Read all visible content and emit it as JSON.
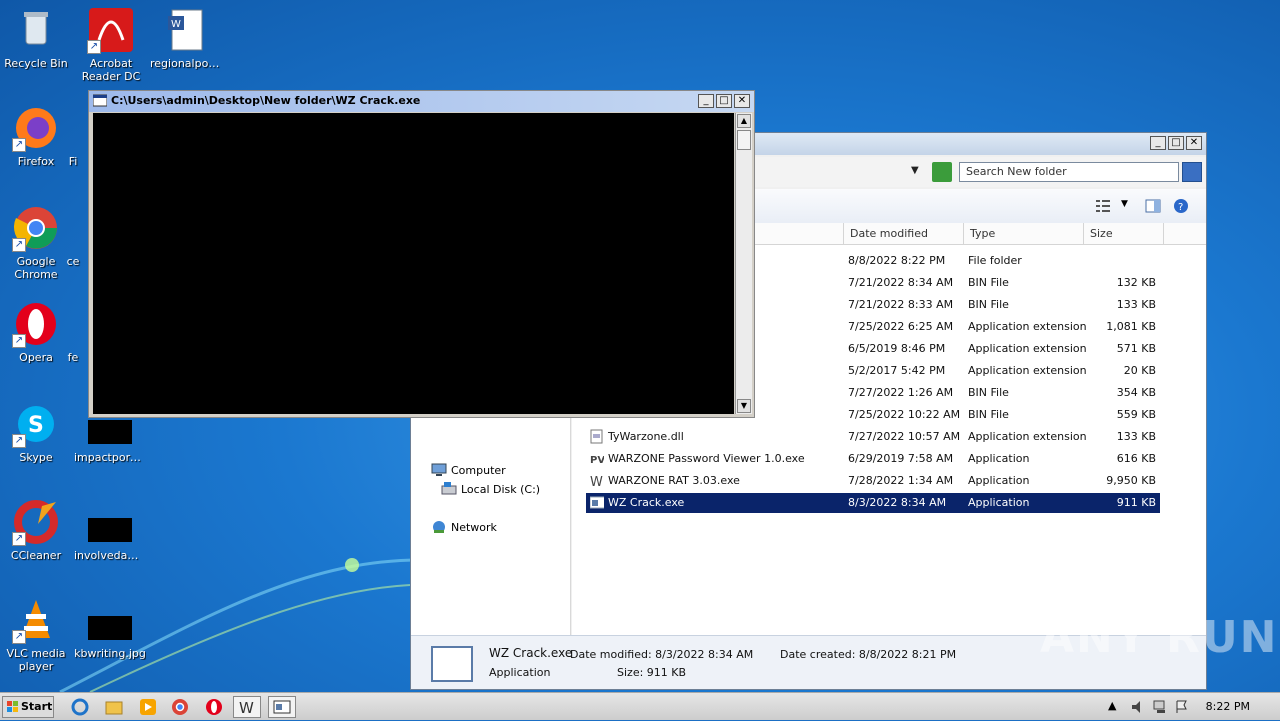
{
  "desktop": {
    "icons": [
      {
        "label": "Recycle Bin"
      },
      {
        "label": "Acrobat Reader DC"
      },
      {
        "label": "regionalpost..."
      },
      {
        "label": "Firefox"
      },
      {
        "label": "Fi"
      },
      {
        "label": "Google Chrome"
      },
      {
        "label": "ce"
      },
      {
        "label": "Opera"
      },
      {
        "label": "fe"
      },
      {
        "label": "Skype"
      },
      {
        "label": "impactporn..."
      },
      {
        "label": "CCleaner"
      },
      {
        "label": "involvedam..."
      },
      {
        "label": "VLC media player"
      },
      {
        "label": "kbwriting.jpg"
      }
    ]
  },
  "console": {
    "title": "C:\\Users\\admin\\Desktop\\New folder\\WZ Crack.exe"
  },
  "explorer": {
    "search_placeholder": "Search New folder",
    "columns": [
      "Date modified",
      "Type",
      "Size"
    ],
    "nav": [
      {
        "label": "Computer"
      },
      {
        "label": "Local Disk (C:)"
      },
      {
        "label": "Network"
      }
    ],
    "files": [
      {
        "name": "",
        "date": "8/8/2022 8:22 PM",
        "type": "File folder",
        "size": ""
      },
      {
        "name": "",
        "date": "7/21/2022 8:34 AM",
        "type": "BIN File",
        "size": "132 KB"
      },
      {
        "name": "",
        "date": "7/21/2022 8:33 AM",
        "type": "BIN File",
        "size": "133 KB"
      },
      {
        "name": "",
        "date": "7/25/2022 6:25 AM",
        "type": "Application extension",
        "size": "1,081 KB"
      },
      {
        "name": "",
        "date": "6/5/2019 8:46 PM",
        "type": "Application extension",
        "size": "571 KB"
      },
      {
        "name": "",
        "date": "5/2/2017 5:42 PM",
        "type": "Application extension",
        "size": "20 KB"
      },
      {
        "name": "",
        "date": "7/27/2022 1:26 AM",
        "type": "BIN File",
        "size": "354 KB"
      },
      {
        "name": "",
        "date": "7/25/2022 10:22 AM",
        "type": "BIN File",
        "size": "559 KB"
      },
      {
        "name": "TyWarzone.dll",
        "date": "7/27/2022 10:57 AM",
        "type": "Application extension",
        "size": "133 KB"
      },
      {
        "name": "WARZONE Password Viewer 1.0.exe",
        "date": "6/29/2019 7:58 AM",
        "type": "Application",
        "size": "616 KB"
      },
      {
        "name": "WARZONE RAT 3.03.exe",
        "date": "7/28/2022 1:34 AM",
        "type": "Application",
        "size": "9,950 KB"
      },
      {
        "name": "WZ Crack.exe",
        "date": "8/3/2022 8:34 AM",
        "type": "Application",
        "size": "911 KB"
      }
    ],
    "details": {
      "name": "WZ Crack.exe",
      "kind": "Application",
      "date_modified": "Date modified: 8/3/2022 8:34 AM",
      "size": "Size: 911 KB",
      "date_created": "Date created: 8/8/2022 8:21 PM"
    }
  },
  "taskbar": {
    "start_label": "Start",
    "clock": "8:22 PM"
  },
  "watermark": "ANY RUN"
}
